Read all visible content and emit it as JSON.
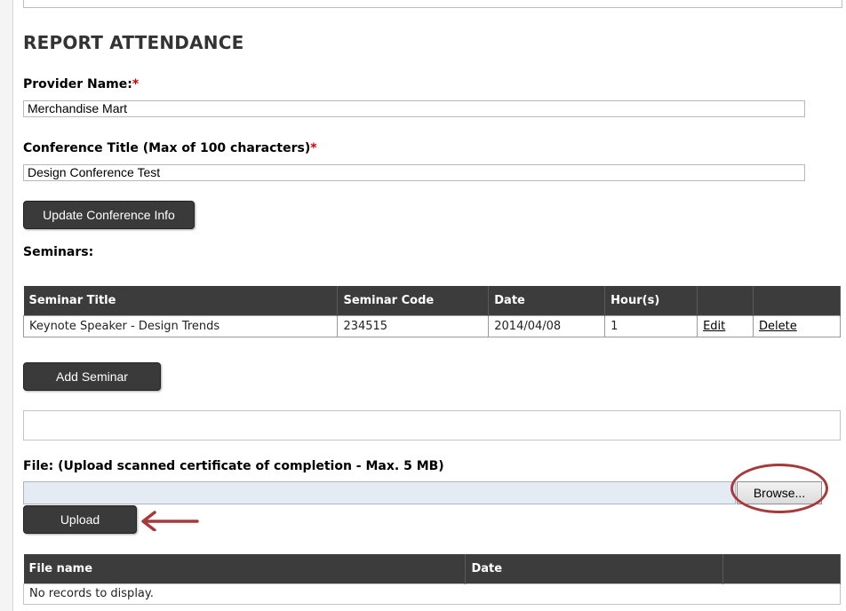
{
  "page": {
    "heading": "REPORT ATTENDANCE"
  },
  "provider": {
    "label": "Provider Name:",
    "required_mark": "*",
    "value": "Merchandise Mart"
  },
  "conference": {
    "label": "Conference Title (Max of 100 characters)",
    "required_mark": "*",
    "value": "Design Conference Test"
  },
  "buttons": {
    "update_conference": "Update Conference Info",
    "add_seminar": "Add Seminar",
    "upload": "Upload",
    "browse": "Browse..."
  },
  "seminars": {
    "label": "Seminars:",
    "columns": [
      "Seminar Title",
      "Seminar Code",
      "Date",
      "Hour(s)",
      "",
      ""
    ],
    "rows": [
      {
        "title": "Keynote Speaker - Design Trends",
        "code": "234515",
        "date": "2014/04/08",
        "hours": "1",
        "edit": "Edit",
        "delete": "Delete"
      }
    ]
  },
  "file_upload": {
    "label": "File: (Upload scanned certificate of completion - Max. 5 MB)",
    "value": ""
  },
  "files_table": {
    "columns": [
      "File name",
      "Date",
      ""
    ],
    "empty_message": "No records to display."
  },
  "colors": {
    "header_bg": "#3c3c3c",
    "button_bg": "#3a3a3a",
    "required": "#cc0000",
    "annotation": "#a63a3a"
  }
}
